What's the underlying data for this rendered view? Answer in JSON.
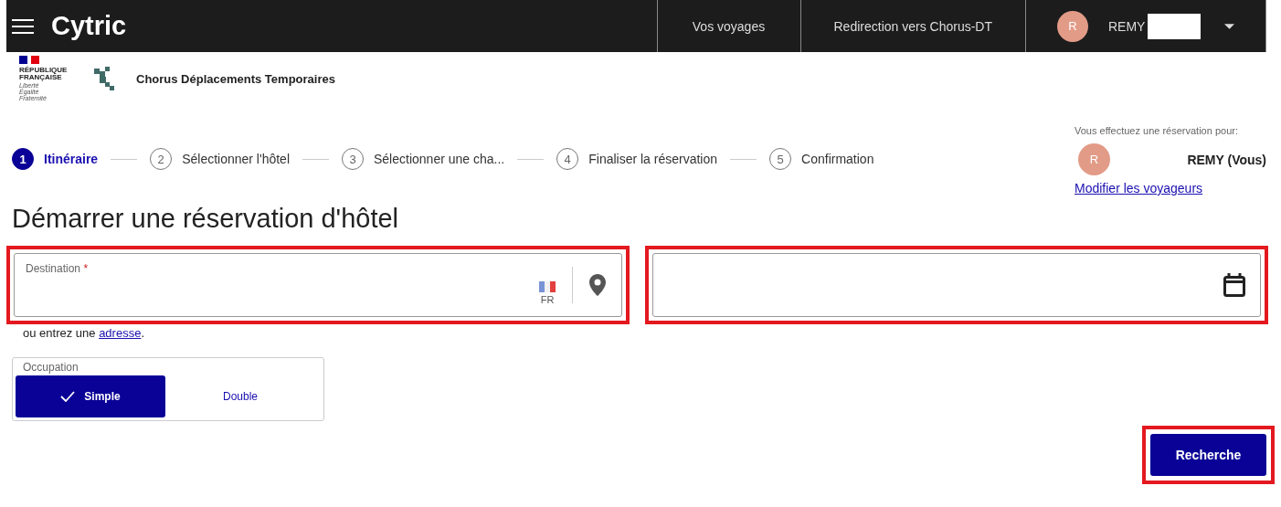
{
  "app_bar": {
    "brand": "Cytric",
    "nav": [
      {
        "label": "Vos voyages"
      },
      {
        "label": "Redirection vers Chorus-DT"
      }
    ],
    "user": {
      "initial": "R",
      "name": "REMY",
      "redacted": true
    }
  },
  "header": {
    "marianne": {
      "line1": "RÉPUBLIQUE",
      "line2": "FRANÇAISE",
      "motto": [
        "Liberté",
        "Égalité",
        "Fraternité"
      ]
    },
    "service": "Chorus Déplacements Temporaires"
  },
  "steps": [
    {
      "number": "1",
      "label": "Itinéraire",
      "selected": true
    },
    {
      "number": "2",
      "label": "Sélectionner l'hôtel",
      "selected": false
    },
    {
      "number": "3",
      "label": "Sélectionner une cha...",
      "selected": false
    },
    {
      "number": "4",
      "label": "Finaliser la réservation",
      "selected": false
    },
    {
      "number": "5",
      "label": "Confirmation",
      "selected": false
    }
  ],
  "traveler_panel": {
    "caption": "Vous effectuez une réservation pour:",
    "initial": "R",
    "name": "REMY (Vous)",
    "link": "Modifier les voyageurs"
  },
  "title": "Démarrer une réservation d'hôtel",
  "destination": {
    "label": "Destination",
    "required_mark": "*",
    "country": "FR",
    "highlighted": true
  },
  "dates": {
    "highlighted": true
  },
  "address_hint": {
    "before": "ou entrez une ",
    "link": "adresse",
    "after": "."
  },
  "occupation": {
    "label": "Occupation",
    "options": [
      {
        "label": "Simple",
        "selected": true
      },
      {
        "label": "Double",
        "selected": false
      }
    ]
  },
  "search_button": {
    "label": "Recherche",
    "highlighted": true
  }
}
